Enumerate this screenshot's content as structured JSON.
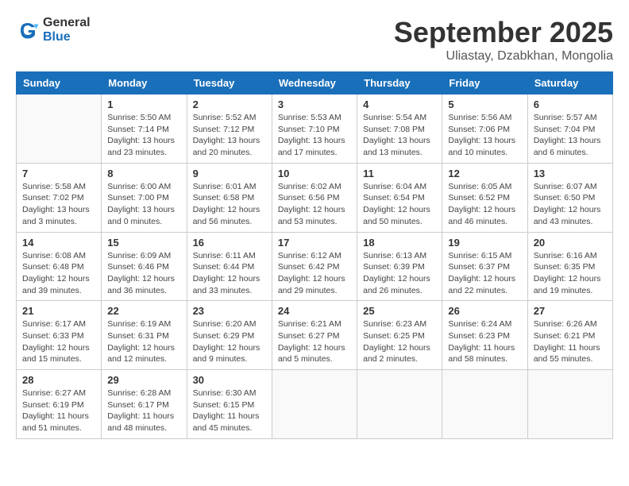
{
  "header": {
    "logo_line1": "General",
    "logo_line2": "Blue",
    "month_title": "September 2025",
    "location": "Uliastay, Dzabkhan, Mongolia"
  },
  "weekdays": [
    "Sunday",
    "Monday",
    "Tuesday",
    "Wednesday",
    "Thursday",
    "Friday",
    "Saturday"
  ],
  "weeks": [
    [
      {
        "day": "",
        "info": ""
      },
      {
        "day": "1",
        "info": "Sunrise: 5:50 AM\nSunset: 7:14 PM\nDaylight: 13 hours\nand 23 minutes."
      },
      {
        "day": "2",
        "info": "Sunrise: 5:52 AM\nSunset: 7:12 PM\nDaylight: 13 hours\nand 20 minutes."
      },
      {
        "day": "3",
        "info": "Sunrise: 5:53 AM\nSunset: 7:10 PM\nDaylight: 13 hours\nand 17 minutes."
      },
      {
        "day": "4",
        "info": "Sunrise: 5:54 AM\nSunset: 7:08 PM\nDaylight: 13 hours\nand 13 minutes."
      },
      {
        "day": "5",
        "info": "Sunrise: 5:56 AM\nSunset: 7:06 PM\nDaylight: 13 hours\nand 10 minutes."
      },
      {
        "day": "6",
        "info": "Sunrise: 5:57 AM\nSunset: 7:04 PM\nDaylight: 13 hours\nand 6 minutes."
      }
    ],
    [
      {
        "day": "7",
        "info": "Sunrise: 5:58 AM\nSunset: 7:02 PM\nDaylight: 13 hours\nand 3 minutes."
      },
      {
        "day": "8",
        "info": "Sunrise: 6:00 AM\nSunset: 7:00 PM\nDaylight: 13 hours\nand 0 minutes."
      },
      {
        "day": "9",
        "info": "Sunrise: 6:01 AM\nSunset: 6:58 PM\nDaylight: 12 hours\nand 56 minutes."
      },
      {
        "day": "10",
        "info": "Sunrise: 6:02 AM\nSunset: 6:56 PM\nDaylight: 12 hours\nand 53 minutes."
      },
      {
        "day": "11",
        "info": "Sunrise: 6:04 AM\nSunset: 6:54 PM\nDaylight: 12 hours\nand 50 minutes."
      },
      {
        "day": "12",
        "info": "Sunrise: 6:05 AM\nSunset: 6:52 PM\nDaylight: 12 hours\nand 46 minutes."
      },
      {
        "day": "13",
        "info": "Sunrise: 6:07 AM\nSunset: 6:50 PM\nDaylight: 12 hours\nand 43 minutes."
      }
    ],
    [
      {
        "day": "14",
        "info": "Sunrise: 6:08 AM\nSunset: 6:48 PM\nDaylight: 12 hours\nand 39 minutes."
      },
      {
        "day": "15",
        "info": "Sunrise: 6:09 AM\nSunset: 6:46 PM\nDaylight: 12 hours\nand 36 minutes."
      },
      {
        "day": "16",
        "info": "Sunrise: 6:11 AM\nSunset: 6:44 PM\nDaylight: 12 hours\nand 33 minutes."
      },
      {
        "day": "17",
        "info": "Sunrise: 6:12 AM\nSunset: 6:42 PM\nDaylight: 12 hours\nand 29 minutes."
      },
      {
        "day": "18",
        "info": "Sunrise: 6:13 AM\nSunset: 6:39 PM\nDaylight: 12 hours\nand 26 minutes."
      },
      {
        "day": "19",
        "info": "Sunrise: 6:15 AM\nSunset: 6:37 PM\nDaylight: 12 hours\nand 22 minutes."
      },
      {
        "day": "20",
        "info": "Sunrise: 6:16 AM\nSunset: 6:35 PM\nDaylight: 12 hours\nand 19 minutes."
      }
    ],
    [
      {
        "day": "21",
        "info": "Sunrise: 6:17 AM\nSunset: 6:33 PM\nDaylight: 12 hours\nand 15 minutes."
      },
      {
        "day": "22",
        "info": "Sunrise: 6:19 AM\nSunset: 6:31 PM\nDaylight: 12 hours\nand 12 minutes."
      },
      {
        "day": "23",
        "info": "Sunrise: 6:20 AM\nSunset: 6:29 PM\nDaylight: 12 hours\nand 9 minutes."
      },
      {
        "day": "24",
        "info": "Sunrise: 6:21 AM\nSunset: 6:27 PM\nDaylight: 12 hours\nand 5 minutes."
      },
      {
        "day": "25",
        "info": "Sunrise: 6:23 AM\nSunset: 6:25 PM\nDaylight: 12 hours\nand 2 minutes."
      },
      {
        "day": "26",
        "info": "Sunrise: 6:24 AM\nSunset: 6:23 PM\nDaylight: 11 hours\nand 58 minutes."
      },
      {
        "day": "27",
        "info": "Sunrise: 6:26 AM\nSunset: 6:21 PM\nDaylight: 11 hours\nand 55 minutes."
      }
    ],
    [
      {
        "day": "28",
        "info": "Sunrise: 6:27 AM\nSunset: 6:19 PM\nDaylight: 11 hours\nand 51 minutes."
      },
      {
        "day": "29",
        "info": "Sunrise: 6:28 AM\nSunset: 6:17 PM\nDaylight: 11 hours\nand 48 minutes."
      },
      {
        "day": "30",
        "info": "Sunrise: 6:30 AM\nSunset: 6:15 PM\nDaylight: 11 hours\nand 45 minutes."
      },
      {
        "day": "",
        "info": ""
      },
      {
        "day": "",
        "info": ""
      },
      {
        "day": "",
        "info": ""
      },
      {
        "day": "",
        "info": ""
      }
    ]
  ]
}
